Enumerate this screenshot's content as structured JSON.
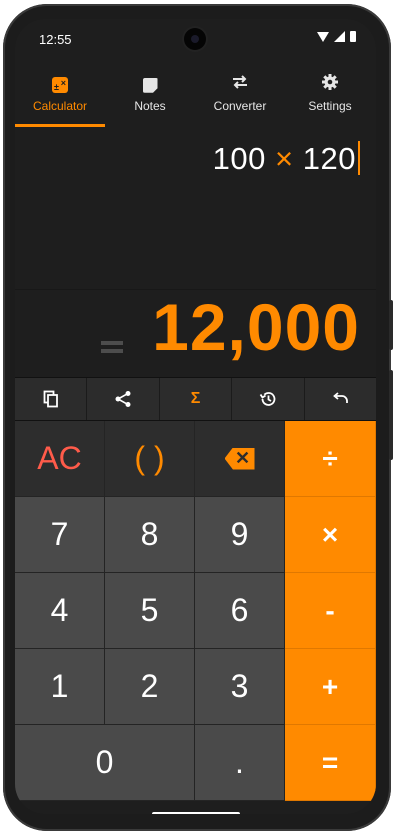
{
  "status_bar": {
    "time": "12:55"
  },
  "tabs": [
    {
      "label": "Calculator",
      "icon": "calculator-icon",
      "active": true
    },
    {
      "label": "Notes",
      "icon": "notes-icon",
      "active": false
    },
    {
      "label": "Converter",
      "icon": "swap-arrows-icon",
      "active": false
    },
    {
      "label": "Settings",
      "icon": "gear-icon",
      "active": false
    }
  ],
  "display": {
    "expression_left": "100",
    "expression_op": "×",
    "expression_right": "120",
    "result": "12,000"
  },
  "toolbar": [
    {
      "icon": "copy-icon"
    },
    {
      "icon": "share-icon"
    },
    {
      "icon": "sigma-icon",
      "label": "Σ"
    },
    {
      "icon": "history-icon"
    },
    {
      "icon": "undo-icon"
    }
  ],
  "keys": {
    "ac": "AC",
    "parens": "( )",
    "backspace_icon": "backspace-icon",
    "divide": "÷",
    "seven": "7",
    "eight": "8",
    "nine": "9",
    "multiply": "×",
    "four": "4",
    "five": "5",
    "six": "6",
    "minus": "-",
    "one": "1",
    "two": "2",
    "three": "3",
    "plus": "+",
    "zero": "0",
    "dot": ".",
    "equals": "="
  },
  "colors": {
    "accent": "#ff8a00",
    "clear": "#ff5b4a",
    "background": "#1e1e1e",
    "key": "#4a4a4a"
  }
}
